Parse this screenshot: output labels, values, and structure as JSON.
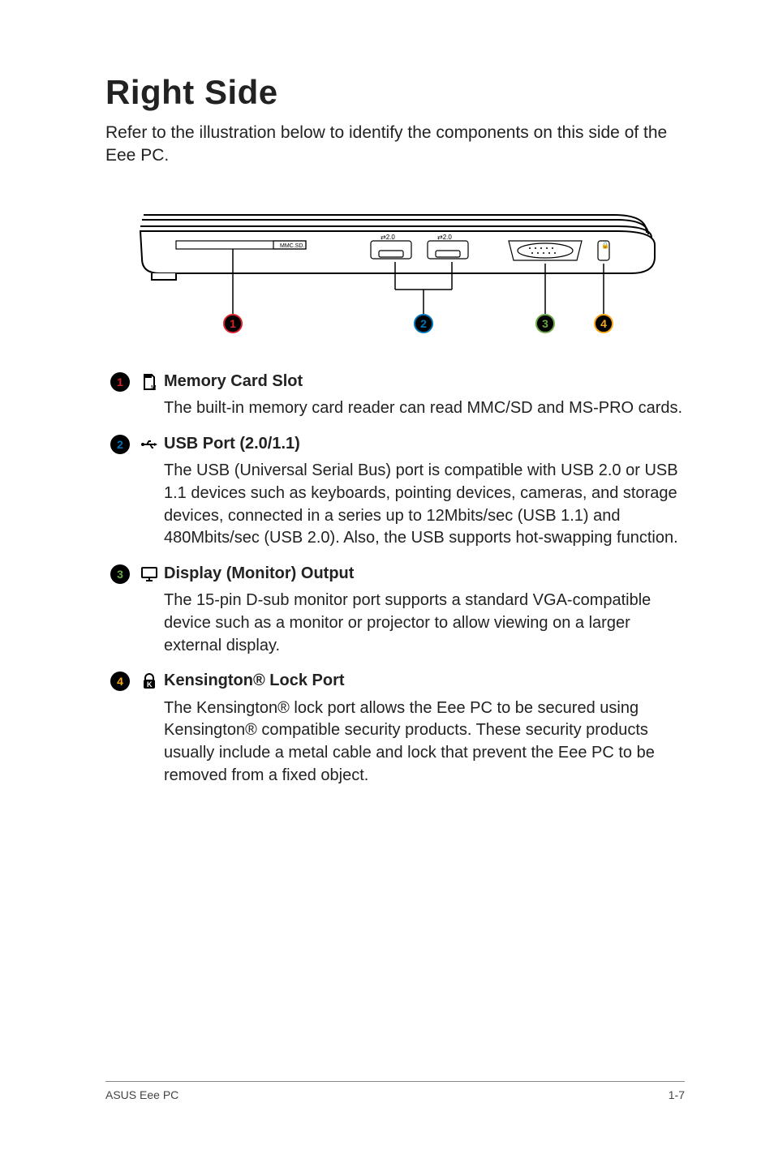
{
  "page": {
    "heading": "Right Side",
    "intro": "Refer to the illustration below to identify the components on this side of the Eee PC.",
    "footer_left": "ASUS Eee PC",
    "footer_right": "1-7"
  },
  "callout_labels": [
    "1",
    "2",
    "3",
    "4"
  ],
  "items": [
    {
      "num": "1",
      "color_class": "c1",
      "icon_key": "memory-card-icon",
      "title": "Memory Card Slot",
      "body": "The built-in memory card reader can read MMC/SD and MS-PRO cards."
    },
    {
      "num": "2",
      "color_class": "c2",
      "icon_key": "usb-icon",
      "title": "USB Port (2.0/1.1)",
      "body": "The USB (Universal Serial Bus) port is compatible with USB 2.0 or USB 1.1 devices such as keyboards, pointing devices, cameras, and storage devices, connected in a series up to 12Mbits/sec (USB 1.1) and 480Mbits/sec (USB 2.0). Also, the USB supports hot-swapping function."
    },
    {
      "num": "3",
      "color_class": "c3",
      "icon_key": "monitor-icon",
      "title": "Display (Monitor) Output",
      "body": "The 15-pin D-sub monitor port supports a standard VGA-compatible device such as a monitor or projector to allow viewing on a larger external display."
    },
    {
      "num": "4",
      "color_class": "c4",
      "icon_key": "lock-icon",
      "title": "Kensington® Lock Port",
      "body": "The Kensington® lock port allows the Eee PC to be secured using Kensington® compatible security products. These security products usually include a metal cable and lock that prevent the Eee PC to be removed from a fixed object."
    }
  ]
}
